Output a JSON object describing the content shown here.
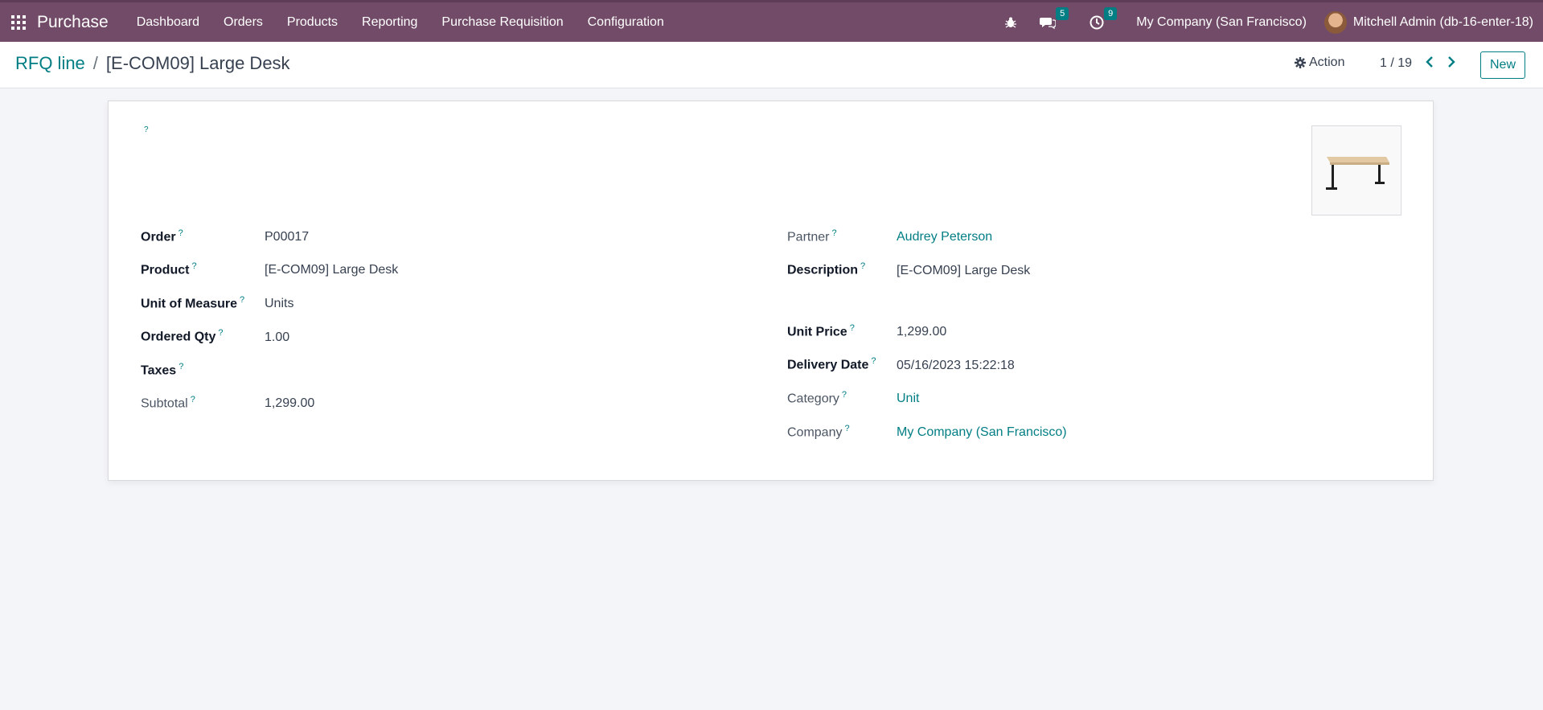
{
  "navbar": {
    "app_name": "Purchase",
    "menu": [
      "Dashboard",
      "Orders",
      "Products",
      "Reporting",
      "Purchase Requisition",
      "Configuration"
    ],
    "messages_count": "5",
    "activities_count": "9",
    "company": "My Company (San Francisco)",
    "user": "Mitchell Admin (db-16-enter-18)",
    "accent_color": "#714b67"
  },
  "control": {
    "breadcrumb_parent": "RFQ line",
    "breadcrumb_sep": "/",
    "breadcrumb_current": "[E-COM09] Large Desk",
    "action_label": "Action",
    "pager": "1 / 19",
    "new_label": "New"
  },
  "form": {
    "help_mark": "?",
    "left": [
      {
        "label": "Order",
        "value": "P00017"
      },
      {
        "label": "Product",
        "value": "[E-COM09] Large Desk"
      },
      {
        "label": "Unit of Measure",
        "value": "Units"
      },
      {
        "label": "Ordered Qty",
        "value": "1.00"
      },
      {
        "label": "Taxes",
        "value": ""
      },
      {
        "label": "Subtotal",
        "value": "1,299.00"
      }
    ],
    "right": [
      {
        "label": "Partner",
        "value": "Audrey Peterson"
      },
      {
        "label": "Description",
        "value": "[E-COM09] Large Desk"
      },
      {
        "label": "Unit Price",
        "value": "1,299.00"
      },
      {
        "label": "Delivery Date",
        "value": "05/16/2023 15:22:18"
      },
      {
        "label": "Category",
        "value": "Unit"
      },
      {
        "label": "Company",
        "value": "My Company (San Francisco)"
      }
    ]
  }
}
